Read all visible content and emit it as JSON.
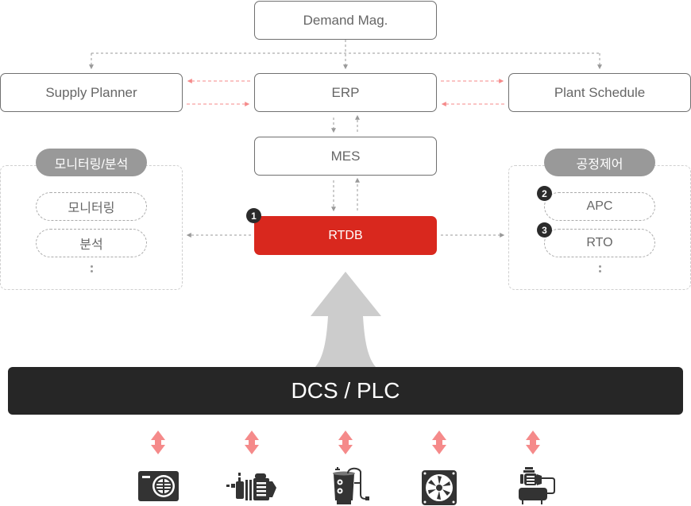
{
  "nodes": {
    "demand": "Demand Mag.",
    "supply": "Supply Planner",
    "erp": "ERP",
    "plant": "Plant Schedule",
    "mes": "MES",
    "rtdb": "RTDB",
    "dcs": "DCS / PLC"
  },
  "groups": {
    "monitoring": {
      "title": "모니터링/분석",
      "items": [
        "모니터링",
        "분석"
      ],
      "more": "⋮"
    },
    "control": {
      "title": "공정제어",
      "items": [
        "APC",
        "RTO"
      ],
      "more": "⋮"
    }
  },
  "badges": [
    "1",
    "2",
    "3"
  ],
  "colors": {
    "accent": "#d9281e",
    "dark": "#262626",
    "gray_arrow": "#999999",
    "pink_arrow": "#f58a8a",
    "big_arrow": "#cccccc"
  },
  "devices": [
    {
      "icon": "heat-exchanger-icon"
    },
    {
      "icon": "pump-motor-icon"
    },
    {
      "icon": "boiler-tank-icon"
    },
    {
      "icon": "fan-icon"
    },
    {
      "icon": "compressor-icon"
    }
  ]
}
